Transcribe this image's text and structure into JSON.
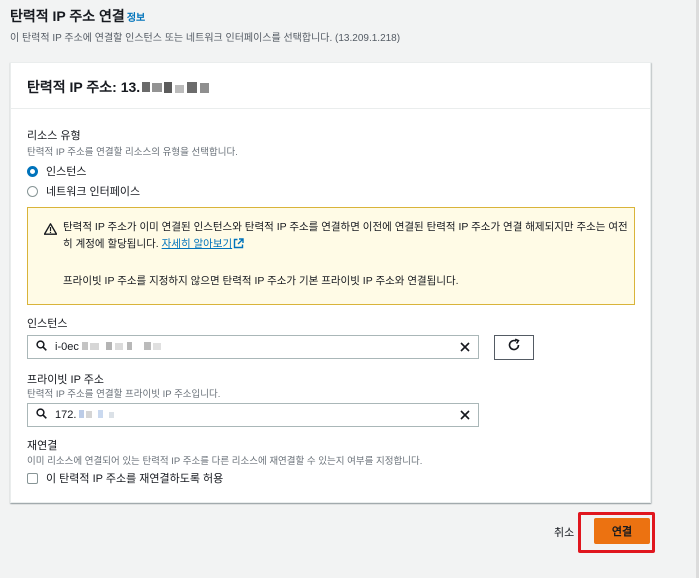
{
  "page": {
    "title": "탄력적 IP 주소 연결",
    "info_link": "정보",
    "description": "이 탄력적 IP 주소에 연결할 인스턴스 또는 네트워크 인터페이스를 선택합니다. (13.209.1.218)"
  },
  "panel": {
    "title": "탄력적 IP 주소: 13."
  },
  "resource_type": {
    "label": "리소스 유형",
    "description": "탄력적 IP 주소를 연결할 리소스의 유형을 선택합니다.",
    "options": [
      {
        "label": "인스턴스",
        "selected": true
      },
      {
        "label": "네트워크 인터페이스",
        "selected": false
      }
    ]
  },
  "alert": {
    "text": "탄력적 IP 주소가 이미 연결된 인스턴스와 탄력적 IP 주소를 연결하면 이전에 연결된 탄력적 IP 주소가 연결 해제되지만 주소는 여전히 계정에 할당됩니다.",
    "link": "자세히 알아보기",
    "note": "프라이빗 IP 주소를 지정하지 않으면 탄력적 IP 주소가 기본 프라이빗 IP 주소와 연결됩니다."
  },
  "instance": {
    "label": "인스턴스",
    "value": "i-0ec"
  },
  "private_ip": {
    "label": "프라이빗 IP 주소",
    "description": "탄력적 IP 주소를 연결할 프라이빗 IP 주소입니다.",
    "value": "172."
  },
  "reassociate": {
    "label": "재연결",
    "description": "이미 리소스에 연결되어 있는 탄력적 IP 주소를 다른 리소스에 재연결할 수 있는지 여부를 지정합니다.",
    "checkbox_label": "이 탄력적 IP 주소를 재연결하도록 허용",
    "checked": false
  },
  "footer": {
    "cancel": "취소",
    "connect": "연결"
  },
  "colors": {
    "primary": "#ec7211",
    "link": "#0073bb",
    "highlight": "#e0161e",
    "alert_bg": "#fffbe6"
  }
}
